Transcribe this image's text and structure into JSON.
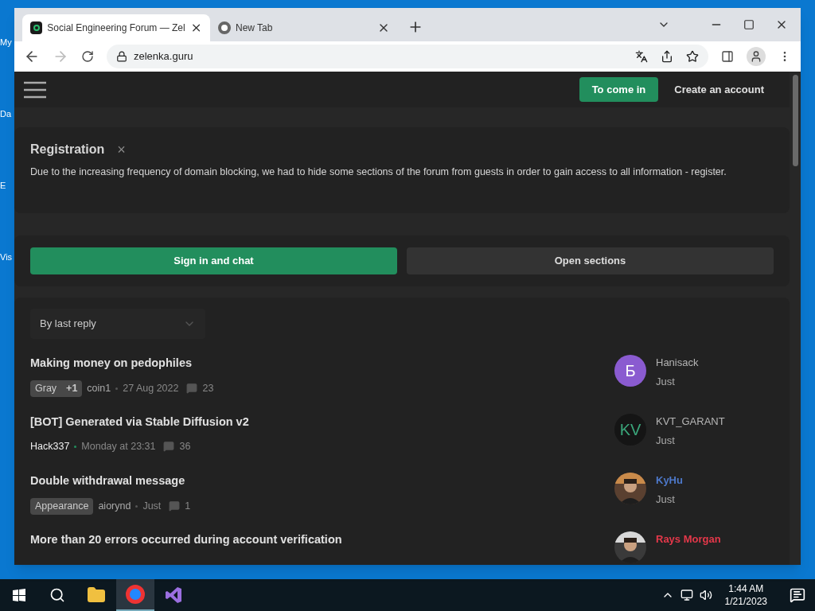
{
  "desktop": {
    "icon_labels": [
      "My",
      "Da",
      "E",
      "Vis"
    ]
  },
  "browser": {
    "tabs": [
      {
        "title": "Social Engineering Forum — Zel",
        "selected": true,
        "kind": "site"
      },
      {
        "title": "New Tab",
        "selected": false,
        "kind": "chrome"
      }
    ],
    "url": "zelenka.guru"
  },
  "header": {
    "login": "To come in",
    "register": "Create an account"
  },
  "notice": {
    "title": "Registration",
    "close": "×",
    "text": "Due to the increasing frequency of domain blocking, we had to hide some sections of the forum from guests in order to gain access to all information - register."
  },
  "actions": [
    {
      "label": "Sign in and chat",
      "kind": "primary"
    },
    {
      "label": "Open sections",
      "kind": "secondary"
    }
  ],
  "sort": {
    "value": "By last reply"
  },
  "threads": [
    {
      "title": "Making money on pedophiles",
      "tags": [
        "Gray",
        "+1"
      ],
      "author": "coin1",
      "author_highlight": false,
      "date": "27 Aug 2022",
      "replies": "23",
      "last_user": "Hanisack",
      "color": "#b5b5b5",
      "avatar": {
        "kind": "letter",
        "text": "Б",
        "color": "#8a5bd0"
      },
      "last_time": "Just"
    },
    {
      "title": "[BOT] Generated via Stable Diffusion v2",
      "author": "Hack337",
      "author_highlight": true,
      "date": "Monday at 23:31",
      "replies": "36",
      "last_user": "KVT_GARANT",
      "color": "#b5b5b5",
      "avatar": {
        "kind": "letter",
        "text": "KV",
        "color": "#151515"
      },
      "last_time": "Just"
    },
    {
      "title": "Double withdrawal message",
      "tags": [
        "Appearance"
      ],
      "author": "aiorynd",
      "author_highlight": false,
      "date": "Just",
      "replies": "1",
      "last_user": "KyHu",
      "color": "#4d78c9",
      "avatar": {
        "kind": "picture"
      },
      "last_time": "Just"
    },
    {
      "title": "More than 20 errors occurred during account verification",
      "last_user": "Rays Morgan",
      "color": "#e5384a",
      "avatar": {
        "kind": "picture"
      }
    }
  ],
  "taskbar": {
    "time": "1:44 AM",
    "date": "1/21/2023"
  }
}
